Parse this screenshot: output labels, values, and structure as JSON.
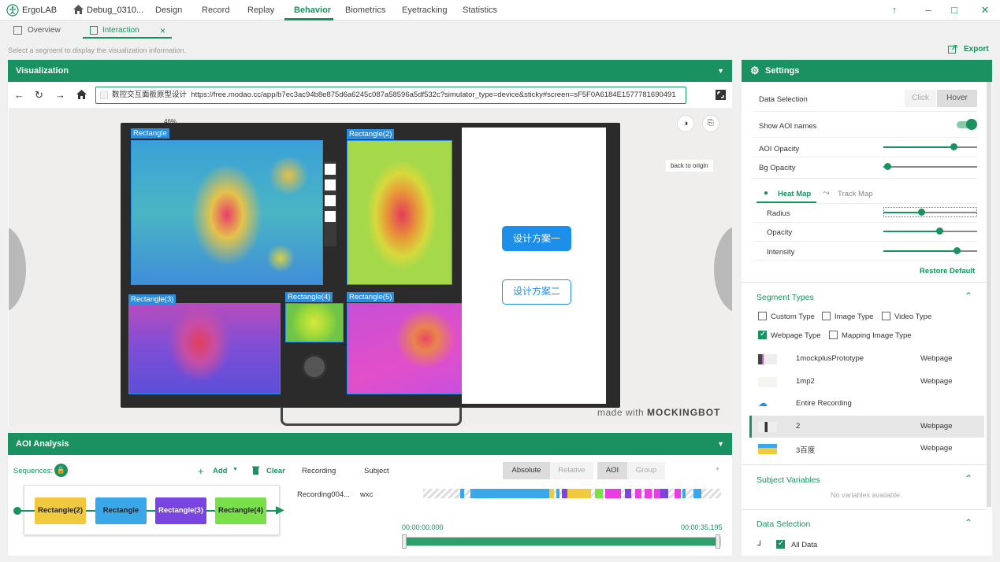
{
  "titlebar": {
    "app_name": "ErgoLAB",
    "project_name": "Debug_0310...",
    "tabs": [
      "Design",
      "Record",
      "Replay",
      "Behavior",
      "Biometrics",
      "Eyetracking",
      "Statistics"
    ],
    "active_tab": "Behavior"
  },
  "subtabs": {
    "overview": "Overview",
    "interaction": "Interaction",
    "close": "×"
  },
  "hint": "Select a segment to display the visualization information.",
  "export_label": "Export",
  "visualization": {
    "title": "Visualization",
    "url_title": "数控交互面板原型设计",
    "url": "https://free.modao.cc/app/b7ec3ac94b8e875d6a6245c087a58596a5df532c?simulator_type=device&sticky#screen=sF5F0A6184E1577781690491",
    "zoom": "46%",
    "back_to_origin": "back to origin",
    "aois": [
      "Rectangle",
      "Rectangle(2)",
      "Rectangle(3)",
      "Rectangle(4)",
      "Rectangle(5)"
    ],
    "button_primary": "设计方案一",
    "button_secondary": "设计方案二",
    "watermark_prefix": "made with ",
    "watermark_brand": "MOCKINGBOT"
  },
  "aoi_analysis": {
    "title": "AOI Analysis",
    "sequences_label": "Sequences:",
    "add_label": "Add",
    "clear_label": "Clear",
    "col_recording": "Recording",
    "col_subject": "Subject",
    "btn_absolute": "Absolute",
    "btn_relative": "Relative",
    "btn_aoi": "AOI",
    "btn_group": "Group",
    "sequence": [
      "Rectangle(2)",
      "Rectangle",
      "Rectangle(3)",
      "Rectangle(4)"
    ],
    "row_recording": "Recording004...",
    "row_subject": "wxc",
    "time_start": "00:00:00.000",
    "time_end": "00:00:35.195"
  },
  "settings": {
    "title": "Settings",
    "data_selection_label": "Data Selection",
    "click_label": "Click",
    "hover_label": "Hover",
    "show_aoi_names": "Show AOI names",
    "aoi_opacity": "AOI Opacity",
    "bg_opacity": "Bg Opacity",
    "heat_map_tab": "Heat Map",
    "track_map_tab": "Track Map",
    "radius": "Radius",
    "opacity": "Opacity",
    "intensity": "Intensity",
    "restore_default": "Restore Default",
    "sliders": {
      "aoi_opacity": 0.75,
      "bg_opacity": 0.04,
      "radius": 0.4,
      "opacity": 0.6,
      "intensity": 0.78
    },
    "segment_types_title": "Segment Types",
    "types": [
      {
        "label": "Custom Type",
        "checked": false
      },
      {
        "label": "Image Type",
        "checked": false
      },
      {
        "label": "Video Type",
        "checked": false
      },
      {
        "label": "Webpage Type",
        "checked": true
      },
      {
        "label": "Mapping Image Type",
        "checked": false
      }
    ],
    "segments": [
      {
        "name": "1mockplusPrototype",
        "type": "Webpage"
      },
      {
        "name": "1mp2",
        "type": "Webpage"
      },
      {
        "name": "Entire Recording",
        "type": ""
      },
      {
        "name": "2",
        "type": "Webpage"
      },
      {
        "name": "3百度",
        "type": "Webpage"
      }
    ],
    "subject_variables_title": "Subject Variables",
    "no_variables": "No variables available.",
    "data_selection_title": "Data Selection",
    "all_data": "All Data"
  },
  "colors": {
    "accent": "#1a9160",
    "aoi": "#2a8de0"
  }
}
